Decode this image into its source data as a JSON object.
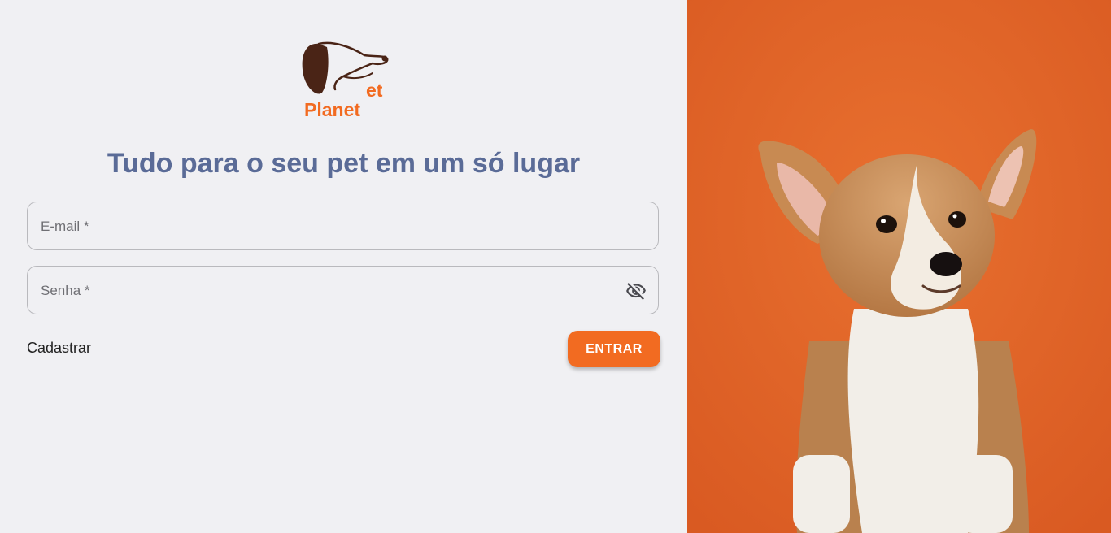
{
  "logo": {
    "word": "Planet",
    "et": "et",
    "brand_color": "#f26b21",
    "ear_color": "#4a2416"
  },
  "headline": "Tudo para o seu pet em um só lugar",
  "form": {
    "email_placeholder": "E-mail *",
    "password_placeholder": "Senha *",
    "password_toggle_icon": "eye-off-icon",
    "register_label": "Cadastrar",
    "submit_label": "ENTRAR"
  },
  "colors": {
    "accent": "#f26b21",
    "headline": "#5a6b97",
    "panel_background": "#f0f0f3",
    "photo_background": "#e2642a"
  },
  "hero_image": {
    "subject": "corgi-puppy-photo"
  }
}
